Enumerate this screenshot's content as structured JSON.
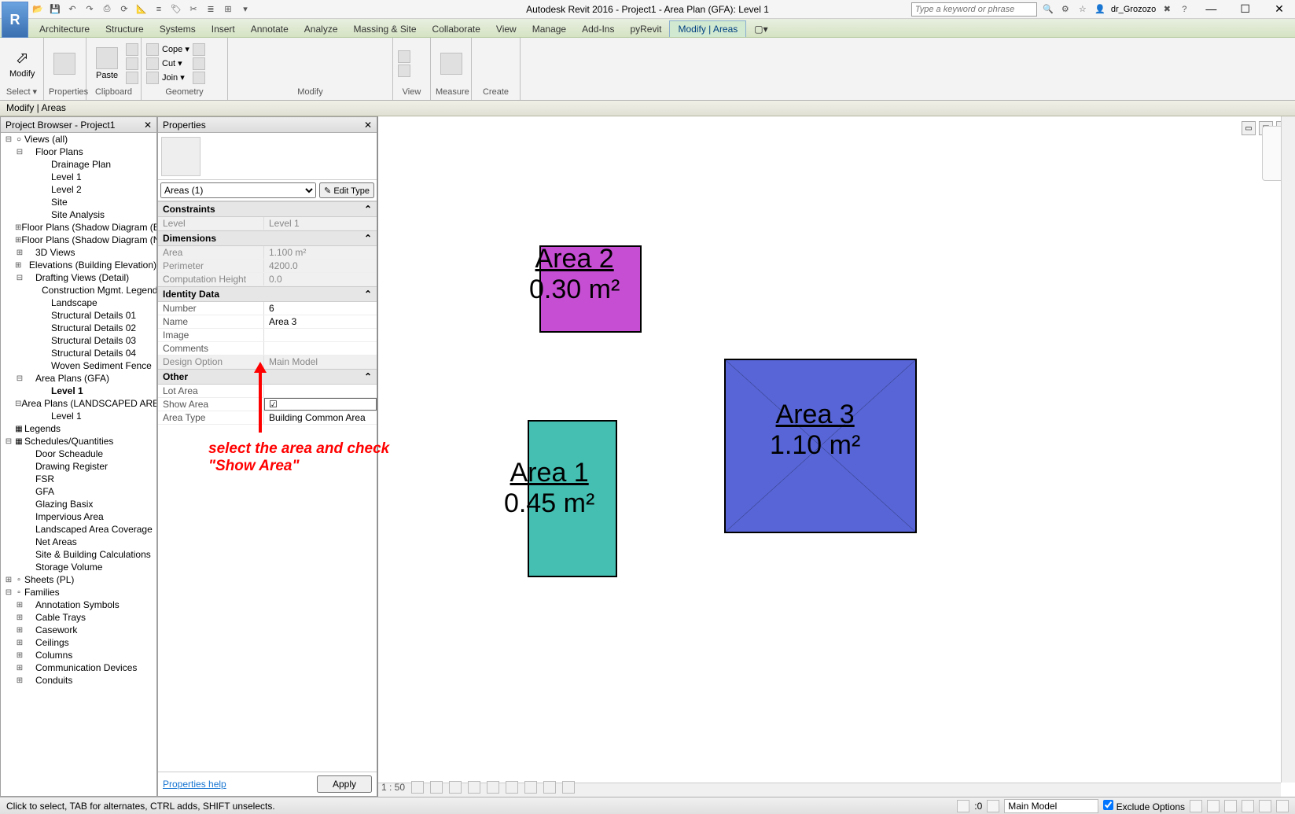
{
  "window": {
    "title": "Autodesk Revit 2016 -     Project1 - Area Plan (GFA): Level 1",
    "search_placeholder": "Type a keyword or phrase",
    "user": "dr_Grozozo"
  },
  "ribbon": {
    "tabs": [
      "Architecture",
      "Structure",
      "Systems",
      "Insert",
      "Annotate",
      "Analyze",
      "Massing & Site",
      "Collaborate",
      "View",
      "Manage",
      "Add-Ins",
      "pyRevit",
      "Modify | Areas"
    ],
    "active_tab": "Modify | Areas",
    "panels": {
      "select": "Select ▾",
      "properties": "Properties",
      "clipboard": "Clipboard",
      "geometry": "Geometry",
      "modify": "Modify",
      "view": "View",
      "measure": "Measure",
      "create": "Create"
    },
    "modify_btn": "Modify",
    "paste_btn": "Paste",
    "cope": "Cope ▾",
    "cut": "Cut ▾",
    "join": "Join ▾"
  },
  "optionsbar": {
    "text": "Modify | Areas"
  },
  "project_browser": {
    "title": "Project Browser - Project1",
    "tree": [
      {
        "indent": 0,
        "exp": "-",
        "label": "Views (all)",
        "icon": "○"
      },
      {
        "indent": 1,
        "exp": "-",
        "label": "Floor Plans"
      },
      {
        "indent": 3,
        "label": "Drainage Plan"
      },
      {
        "indent": 3,
        "label": "Level 1"
      },
      {
        "indent": 3,
        "label": "Level 2"
      },
      {
        "indent": 3,
        "label": "Site"
      },
      {
        "indent": 3,
        "label": "Site Analysis"
      },
      {
        "indent": 1,
        "exp": "+",
        "label": "Floor Plans (Shadow Diagram (E"
      },
      {
        "indent": 1,
        "exp": "+",
        "label": "Floor Plans (Shadow Diagram (N"
      },
      {
        "indent": 1,
        "exp": "+",
        "label": "3D Views"
      },
      {
        "indent": 1,
        "exp": "+",
        "label": "Elevations (Building Elevation)"
      },
      {
        "indent": 1,
        "exp": "-",
        "label": "Drafting Views (Detail)"
      },
      {
        "indent": 3,
        "label": "Construction Mgmt. Legend"
      },
      {
        "indent": 3,
        "label": "Landscape"
      },
      {
        "indent": 3,
        "label": "Structural Details 01"
      },
      {
        "indent": 3,
        "label": "Structural Details 02"
      },
      {
        "indent": 3,
        "label": "Structural Details 03"
      },
      {
        "indent": 3,
        "label": "Structural Details 04"
      },
      {
        "indent": 3,
        "label": "Woven Sediment Fence"
      },
      {
        "indent": 1,
        "exp": "-",
        "label": "Area Plans (GFA)"
      },
      {
        "indent": 3,
        "label": "Level 1",
        "selected": true
      },
      {
        "indent": 1,
        "exp": "-",
        "label": "Area Plans (LANDSCAPED AREAS"
      },
      {
        "indent": 3,
        "label": "Level 1"
      },
      {
        "indent": 0,
        "exp": "",
        "icon": "▦",
        "label": "Legends"
      },
      {
        "indent": 0,
        "exp": "-",
        "icon": "▦",
        "label": "Schedules/Quantities"
      },
      {
        "indent": 2,
        "label": "Door Scheadule"
      },
      {
        "indent": 2,
        "label": "Drawing Register"
      },
      {
        "indent": 2,
        "label": "FSR"
      },
      {
        "indent": 2,
        "label": "GFA"
      },
      {
        "indent": 2,
        "label": "Glazing Basix"
      },
      {
        "indent": 2,
        "label": "Impervious Area"
      },
      {
        "indent": 2,
        "label": "Landscaped Area Coverage"
      },
      {
        "indent": 2,
        "label": "Net Areas"
      },
      {
        "indent": 2,
        "label": "Site & Building Calculations"
      },
      {
        "indent": 2,
        "label": "Storage Volume"
      },
      {
        "indent": 0,
        "exp": "+",
        "icon": "▫",
        "label": "Sheets (PL)"
      },
      {
        "indent": 0,
        "exp": "-",
        "icon": "▫",
        "label": "Families"
      },
      {
        "indent": 1,
        "exp": "+",
        "label": "Annotation Symbols"
      },
      {
        "indent": 1,
        "exp": "+",
        "label": "Cable Trays"
      },
      {
        "indent": 1,
        "exp": "+",
        "label": "Casework"
      },
      {
        "indent": 1,
        "exp": "+",
        "label": "Ceilings"
      },
      {
        "indent": 1,
        "exp": "+",
        "label": "Columns"
      },
      {
        "indent": 1,
        "exp": "+",
        "label": "Communication Devices"
      },
      {
        "indent": 1,
        "exp": "+",
        "label": "Conduits"
      }
    ]
  },
  "properties": {
    "title": "Properties",
    "type": "Areas (1)",
    "edit_type": "Edit Type",
    "groups": {
      "constraints": "Constraints",
      "dimensions": "Dimensions",
      "identity": "Identity Data",
      "other": "Other"
    },
    "rows": {
      "level_k": "Level",
      "level_v": "Level 1",
      "area_k": "Area",
      "area_v": "1.100 m²",
      "perimeter_k": "Perimeter",
      "perimeter_v": "4200.0",
      "comp_h_k": "Computation Height",
      "comp_h_v": "0.0",
      "number_k": "Number",
      "number_v": "6",
      "name_k": "Name",
      "name_v": "Area 3",
      "image_k": "Image",
      "image_v": "",
      "comments_k": "Comments",
      "comments_v": "",
      "design_k": "Design Option",
      "design_v": "Main Model",
      "lot_k": "Lot Area",
      "lot_v": "",
      "show_k": "Show Area",
      "show_v": "☑",
      "areatype_k": "Area Type",
      "areatype_v": "Building Common Area"
    },
    "help": "Properties help",
    "apply": "Apply"
  },
  "annotation": {
    "line1": "select the area and check",
    "line2": "\"Show Area\""
  },
  "canvas": {
    "areas": [
      {
        "name": "Area 1",
        "value": "0.45 m²"
      },
      {
        "name": "Area 2",
        "value": "0.30 m²"
      },
      {
        "name": "Area 3",
        "value": "1.10 m²"
      }
    ],
    "scale": "1 : 50"
  },
  "statusbar": {
    "hint": "Click to select, TAB for alternates, CTRL adds, SHIFT unselects.",
    "zero": ":0",
    "main_model": "Main Model",
    "exclude": "Exclude Options"
  }
}
